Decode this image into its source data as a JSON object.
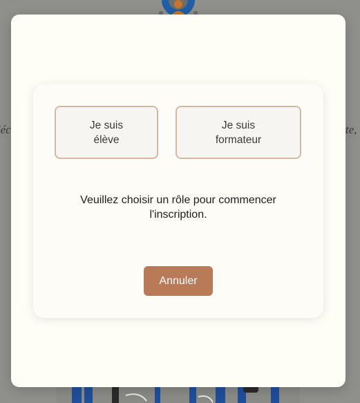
{
  "background": {
    "left_text_fragment": "'éc",
    "right_text_fragment": "te,"
  },
  "role_modal": {
    "roles": [
      {
        "label": "Je suis\nélève"
      },
      {
        "label": "Je suis\nformateur"
      }
    ],
    "prompt": "Veuillez choisir un rôle pour commencer l'inscription.",
    "cancel_label": "Annuler"
  },
  "colors": {
    "overlay": "#8f8f8c",
    "modal_bg": "#fefef6",
    "role_border": "#d4b8a3",
    "cancel_bg": "#b97a57",
    "logo_blue": "#1f5fa8",
    "logo_orange": "#c8762c"
  },
  "icons": {
    "logo": "gear-person-logo-icon",
    "illustration": "people-feet-illustration"
  }
}
